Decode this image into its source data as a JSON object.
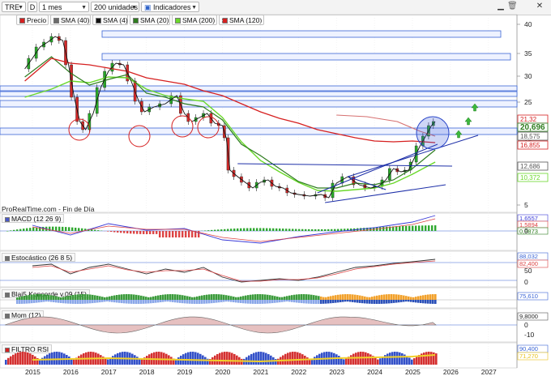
{
  "toolbar": {
    "symbol": "TRE",
    "mode": "D",
    "timeframe": "1 mes",
    "units": "200 unidades",
    "indicators": "Indicadores",
    "legend": [
      {
        "label": "Precio",
        "color": "#d62020"
      },
      {
        "label": "SMA (40)",
        "color": "#6b6b6b"
      },
      {
        "label": "SMA (4)",
        "color": "#111111"
      },
      {
        "label": "SMA (20)",
        "color": "#2e7d1f"
      },
      {
        "label": "SMA (200)",
        "color": "#6ad82a"
      },
      {
        "label": "SMA (120)",
        "color": "#d62020"
      }
    ]
  },
  "attribution": "ProRealTime.com - Fin de Día",
  "price_axis": {
    "ticks": [
      "40",
      "35",
      "30",
      "25",
      "15",
      "5"
    ],
    "badges": [
      {
        "value": "21,32",
        "color": "#d62020"
      },
      {
        "value": "20,696",
        "color": "#2e7d1f"
      },
      {
        "value": "18,575",
        "color": "#555555"
      },
      {
        "value": "16,855",
        "color": "#d62020"
      },
      {
        "value": "12,686",
        "color": "#555555"
      },
      {
        "value": "10,372",
        "color": "#6ad82a"
      }
    ]
  },
  "x_axis": {
    "years": [
      "2015",
      "2016",
      "2017",
      "2018",
      "2019",
      "2020",
      "2021",
      "2022",
      "2023",
      "2024",
      "2025",
      "2026",
      "2027"
    ]
  },
  "panels": {
    "macd": {
      "label": "MACD (12 26 9)",
      "values": [
        "1,6557",
        "1,5894",
        "0,9873"
      ],
      "tick": "0"
    },
    "stoch": {
      "label": "Estocástico (26 8 5)",
      "values": [
        "88,032",
        "82,400"
      ],
      "ticks": [
        "50",
        "0"
      ]
    },
    "koncorde": {
      "label": "Blai5 Koncorde v.09 (15)",
      "values": [
        "75,610"
      ]
    },
    "mom": {
      "label": "Mom (12)",
      "values": [
        "9,8000"
      ],
      "ticks": [
        "0",
        "-10"
      ]
    },
    "rsi": {
      "label": "FILTRO RSI",
      "values": [
        "90,400",
        "71,270"
      ]
    }
  }
}
